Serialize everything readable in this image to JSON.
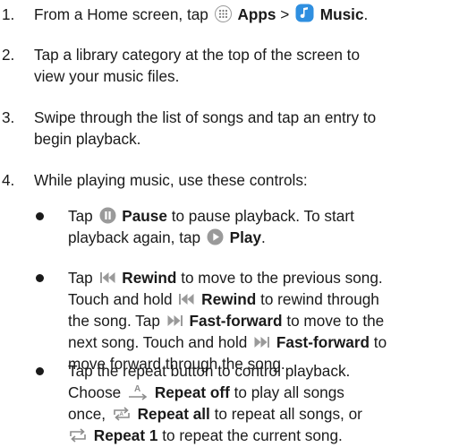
{
  "steps": [
    {
      "num": "1.",
      "t1": "From a Home screen, tap",
      "apps": "Apps",
      "sep": ">",
      "music": "Music",
      "end": "."
    },
    {
      "num": "2.",
      "line1": "Tap a library category at the top of the screen to",
      "line2": "view your music files."
    },
    {
      "num": "3.",
      "line1": "Swipe through the list of songs and tap an entry to",
      "line2": "begin playback."
    },
    {
      "num": "4.",
      "line1": "While playing music, use these controls:"
    }
  ],
  "bullets": {
    "pause": {
      "t1": "Tap",
      "pause": "Pause",
      "t2": "to pause playback. To start",
      "t3": "playback again, tap",
      "play": "Play",
      "t4": "."
    },
    "rewind": {
      "t1": "Tap",
      "rewind": "Rewind",
      "t2": "to move to the previous song.",
      "t3": "Touch and hold",
      "t4": "to rewind through",
      "t5": "the song. Tap",
      "ff": "Fast-forward",
      "t6": "to move to the",
      "t7": "next song. Touch and hold",
      "t8": "to",
      "t9": "move forward through the song."
    },
    "repeat": {
      "t1": "Tap the repeat button to control playback.",
      "t2": "Choose",
      "off": "Repeat off",
      "t3": "to play all songs",
      "t4": "once,",
      "all": "Repeat all",
      "t5": "to repeat all songs, or",
      "one": "Repeat 1",
      "t6": "to repeat the current song."
    }
  },
  "icons": {
    "apps": "apps-grid-icon",
    "music": "music-note-icon",
    "pause": "pause-icon",
    "play": "play-icon",
    "rewind": "rewind-icon",
    "ff": "fast-forward-icon",
    "off": "repeat-off-icon",
    "all": "repeat-all-icon",
    "one": "repeat-one-icon"
  },
  "colors": {
    "text": "#1a1a1a",
    "icon_gray": "#9a9a9a",
    "music_blue": "#2f8fe0",
    "repeat_gray": "#8c8c8c"
  }
}
